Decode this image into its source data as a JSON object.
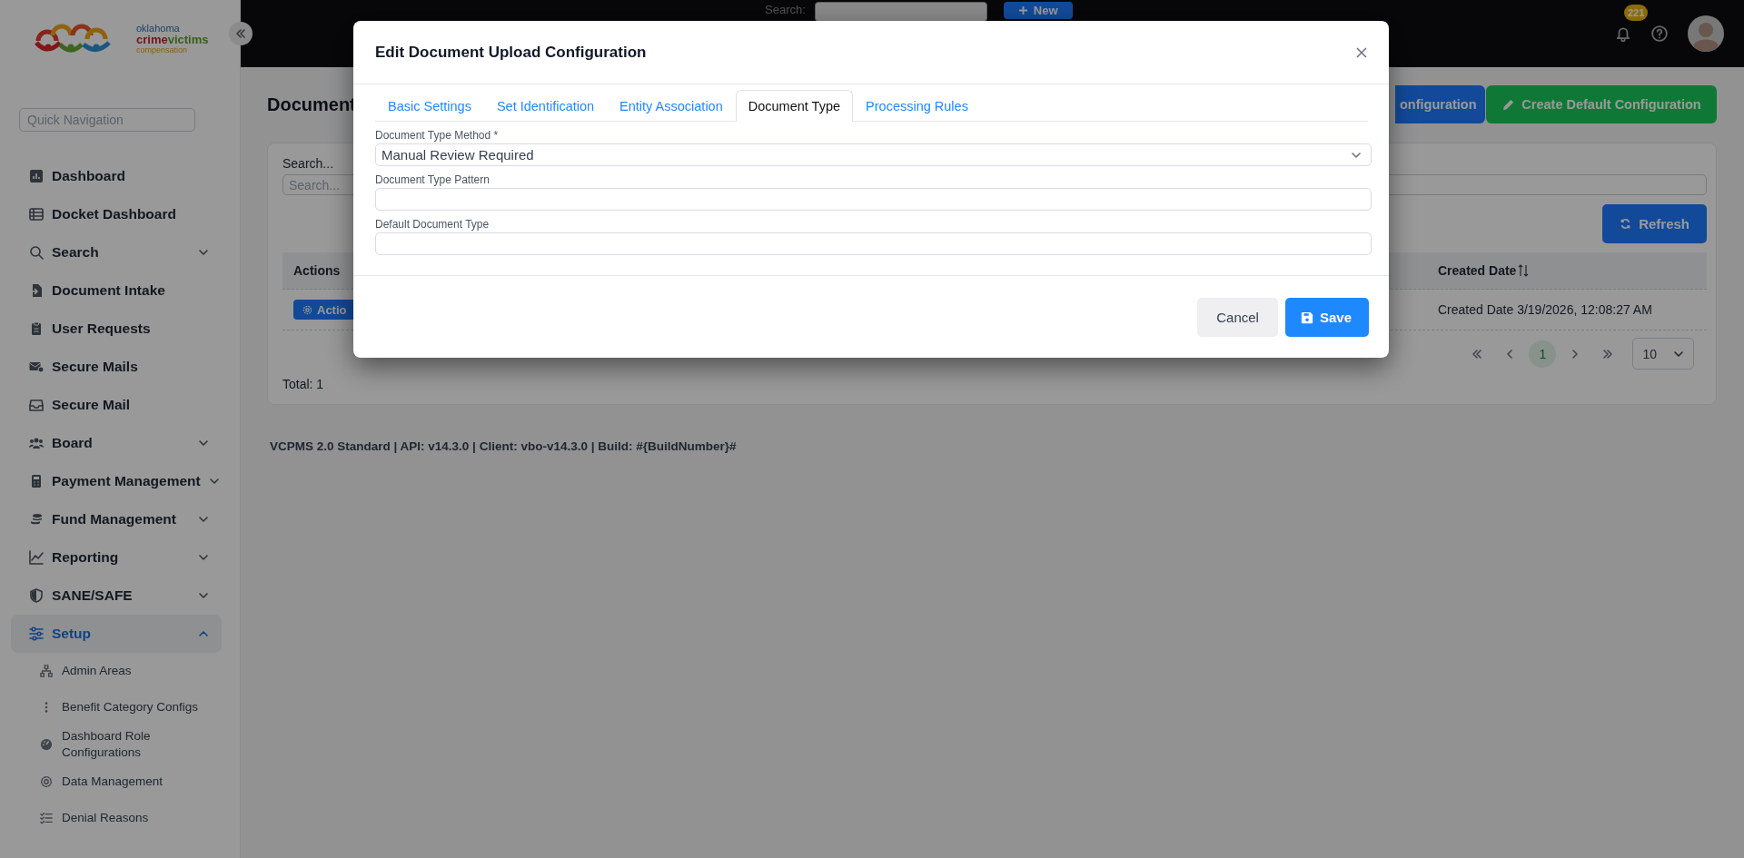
{
  "logo": {
    "line_1": "oklahoma",
    "brand_part_1": "crime",
    "brand_part_2": "victims",
    "line_3": "compensation"
  },
  "sidebar": {
    "quick_navigation": {
      "placeholder": "Quick Navigation"
    },
    "items": [
      {
        "label": "Dashboard",
        "kind": "link",
        "selected": false
      },
      {
        "label": "Docket Dashboard",
        "kind": "link",
        "selected": false
      },
      {
        "label": "Search",
        "kind": "group",
        "selected": false,
        "expanded": false
      },
      {
        "label": "Document Intake",
        "kind": "link",
        "selected": false
      },
      {
        "label": "User Requests",
        "kind": "link",
        "selected": false
      },
      {
        "label": "Secure Mails",
        "kind": "link",
        "selected": false
      },
      {
        "label": "Secure Mail",
        "kind": "link",
        "selected": false
      },
      {
        "label": "Board",
        "kind": "group",
        "selected": false,
        "expanded": false
      },
      {
        "label": "Payment Management",
        "kind": "group",
        "selected": false,
        "expanded": false
      },
      {
        "label": "Fund Management",
        "kind": "group",
        "selected": false,
        "expanded": false
      },
      {
        "label": "Reporting",
        "kind": "group",
        "selected": false,
        "expanded": false
      },
      {
        "label": "SANE/SAFE",
        "kind": "group",
        "selected": false,
        "expanded": false
      },
      {
        "label": "Setup",
        "kind": "group",
        "selected": true,
        "expanded": true,
        "children": [
          {
            "label": "Admin Areas",
            "selected": false
          },
          {
            "label": "Benefit Category Configs",
            "selected": false
          },
          {
            "label": "Dashboard Role Configurations",
            "selected": false
          },
          {
            "label": "Data Management",
            "selected": false
          },
          {
            "label": "Denial Reasons",
            "selected": false
          }
        ]
      }
    ]
  },
  "top_bar": {
    "search_label": "Search:",
    "new_button": "New",
    "notification_count": "221"
  },
  "page": {
    "title": "Document",
    "header_buttons": [
      {
        "label": "onfiguration",
        "kind": "primary"
      },
      {
        "label": "Create Default Configuration",
        "kind": "success"
      }
    ],
    "search_label": "Search...",
    "search": {
      "placeholder": "Search..."
    },
    "refresh_button": "Refresh",
    "table": {
      "columns": [
        {
          "label": "Actions",
          "sortable": false
        },
        {
          "label": "Created Date",
          "sortable": true
        }
      ],
      "rows": [
        {
          "actions": "Actio",
          "created_date": "Created Date 3/19/2026, 12:08:27 AM"
        }
      ]
    },
    "pagination": {
      "pages": [
        {
          "label": "1",
          "selected": true
        }
      ],
      "page_size": "10"
    },
    "total": "Total: 1"
  },
  "footer": "VCPMS 2.0 Standard | API: v14.3.0 | Client: vbo-v14.3.0 | Build: #{BuildNumber}#",
  "modal": {
    "title": "Edit Document Upload Configuration",
    "tabs": [
      {
        "label": "Basic Settings",
        "selected": false
      },
      {
        "label": "Set Identification",
        "selected": false
      },
      {
        "label": "Entity Association",
        "selected": false
      },
      {
        "label": "Document Type",
        "selected": true
      },
      {
        "label": "Processing Rules",
        "selected": false
      }
    ],
    "fields": [
      {
        "kind": "select",
        "label": "Document Type Method *",
        "value": "Manual Review Required"
      },
      {
        "kind": "text",
        "label": "Document Type Pattern"
      },
      {
        "kind": "text",
        "label": "Default Document Type"
      }
    ],
    "cancel_button": "Cancel",
    "save_button": "Save"
  }
}
